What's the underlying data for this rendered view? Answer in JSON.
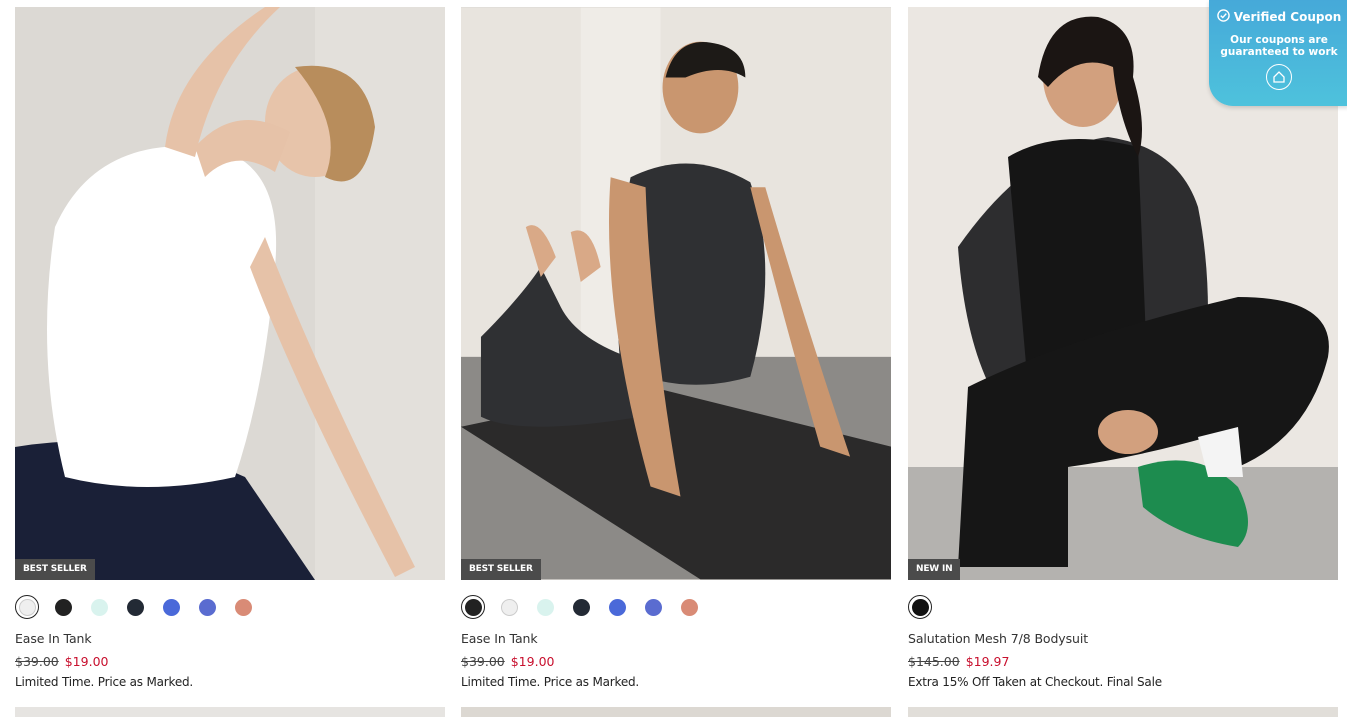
{
  "products": [
    {
      "badge": "BEST SELLER",
      "name": "Ease In Tank",
      "old_price": "$39.00",
      "new_price": "$19.00",
      "promo": "Limited Time. Price as Marked.",
      "swatches": [
        "#efefef",
        "#222222",
        "#d9f3ee",
        "#232a35",
        "#4a69d9",
        "#5a6cd0",
        "#d98b76"
      ],
      "selected_swatch": 0
    },
    {
      "badge": "BEST SELLER",
      "name": "Ease In Tank",
      "old_price": "$39.00",
      "new_price": "$19.00",
      "promo": "Limited Time. Price as Marked.",
      "swatches": [
        "#222222",
        "#efefef",
        "#d9f3ee",
        "#232a35",
        "#4a69d9",
        "#5a6cd0",
        "#d98b76"
      ],
      "selected_swatch": 0
    },
    {
      "badge": "NEW IN",
      "name": "Salutation Mesh 7/8 Bodysuit",
      "old_price": "$145.00",
      "new_price": "$19.97",
      "promo": "Extra 15% Off Taken at Checkout. Final Sale",
      "swatches": [
        "#111111"
      ],
      "selected_swatch": 0
    }
  ],
  "coupon": {
    "title": "Verified Coupon",
    "subtitle": "Our coupons are guaranteed to work",
    "icon": "coupon-logo-icon"
  },
  "colors": {
    "sale_red": "#c8102e",
    "badge_bg": "#4b4b4b",
    "coupon_blue": "#46a9d9"
  }
}
